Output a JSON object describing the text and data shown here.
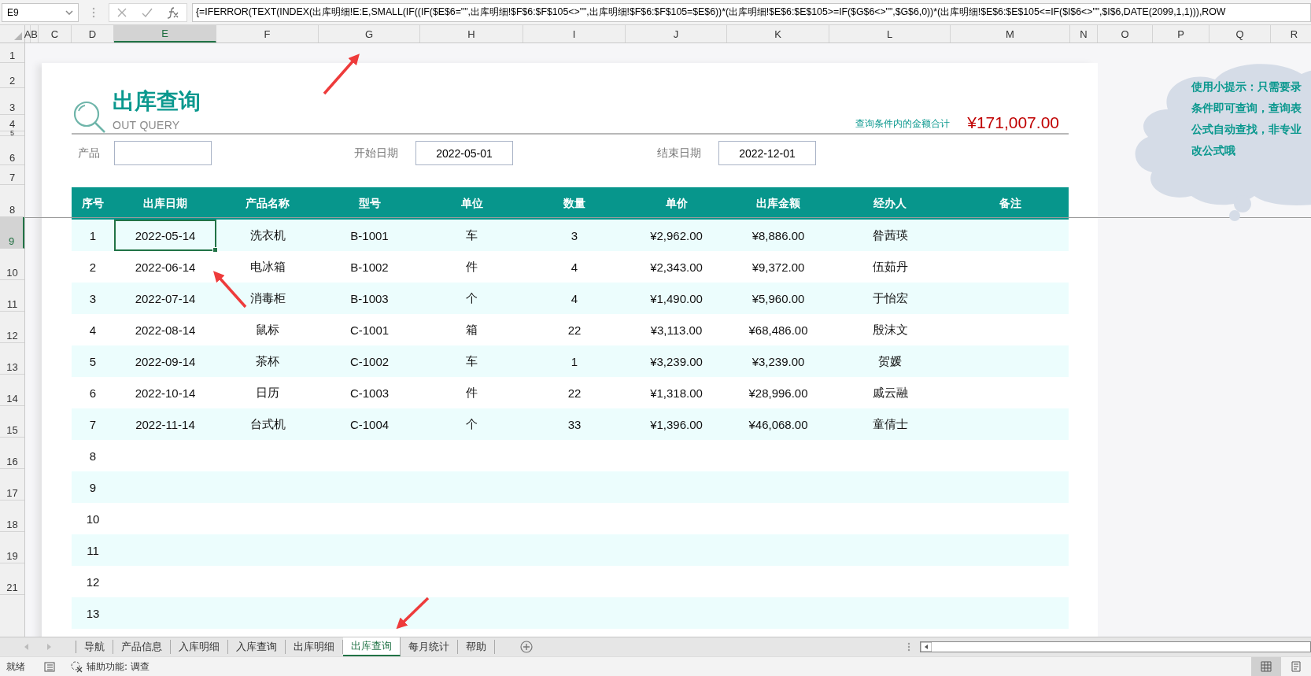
{
  "formula_bar": {
    "name_box": "E9",
    "formula": "{=IFERROR(TEXT(INDEX(出库明细!E:E,SMALL(IF((IF($E$6=\"\",出库明细!$F$6:$F$105<>\"\",出库明细!$F$6:$F$105=$E$6))*(出库明细!$E$6:$E$105>=IF($G$6<>\"\",$G$6,0))*(出库明细!$E$6:$E$105<=IF($I$6<>\"\",$I$6,DATE(2099,1,1))),ROW"
  },
  "column_headers": [
    {
      "label": "A",
      "selected": false
    },
    {
      "label": "B",
      "selected": false
    },
    {
      "label": "C",
      "selected": false
    },
    {
      "label": "D",
      "selected": false
    },
    {
      "label": "E",
      "selected": true
    },
    {
      "label": "F",
      "selected": false
    },
    {
      "label": "G",
      "selected": false
    },
    {
      "label": "H",
      "selected": false
    },
    {
      "label": "I",
      "selected": false
    },
    {
      "label": "J",
      "selected": false
    },
    {
      "label": "K",
      "selected": false
    },
    {
      "label": "L",
      "selected": false
    },
    {
      "label": "M",
      "selected": false
    },
    {
      "label": "N",
      "selected": false
    },
    {
      "label": "O",
      "selected": false
    },
    {
      "label": "P",
      "selected": false
    },
    {
      "label": "Q",
      "selected": false
    },
    {
      "label": "R",
      "selected": false
    }
  ],
  "row_headers": [
    {
      "label": "1",
      "selected": false
    },
    {
      "label": "2",
      "selected": false
    },
    {
      "label": "3",
      "selected": false
    },
    {
      "label": "4",
      "selected": false
    },
    {
      "label": "5",
      "selected": false
    },
    {
      "label": "6",
      "selected": false
    },
    {
      "label": "7",
      "selected": false
    },
    {
      "label": "8",
      "selected": false
    },
    {
      "label": "9",
      "selected": true
    },
    {
      "label": "10",
      "selected": false
    },
    {
      "label": "11",
      "selected": false
    },
    {
      "label": "12",
      "selected": false
    },
    {
      "label": "13",
      "selected": false
    },
    {
      "label": "14",
      "selected": false
    },
    {
      "label": "15",
      "selected": false
    },
    {
      "label": "16",
      "selected": false
    },
    {
      "label": "17",
      "selected": false
    },
    {
      "label": "18",
      "selected": false
    },
    {
      "label": "19",
      "selected": false
    },
    {
      "label": "21",
      "selected": false
    }
  ],
  "title": "出库查询",
  "subtitle": "OUT QUERY",
  "total_label": "查询条件内的金额合计",
  "total_amount": "¥171,007.00",
  "filters": [
    {
      "label": "产品"
    },
    {
      "label": "开始日期",
      "value": "2022-05-01"
    },
    {
      "label": "结束日期",
      "value": "2022-12-01"
    }
  ],
  "table": {
    "columns": [
      "序号",
      "出库日期",
      "产品名称",
      "型号",
      "单位",
      "数量",
      "单价",
      "出库金额",
      "经办人",
      "备注"
    ],
    "rows": [
      {
        "cells": [
          "1",
          "2022-05-14",
          "洗衣机",
          "B-1001",
          "车",
          "3",
          "¥2,962.00",
          "¥8,886.00",
          "昝茜瑛"
        ]
      },
      {
        "cells": [
          "2",
          "2022-06-14",
          "电冰箱",
          "B-1002",
          "件",
          "4",
          "¥2,343.00",
          "¥9,372.00",
          "伍茹丹"
        ]
      },
      {
        "cells": [
          "3",
          "2022-07-14",
          "消毒柜",
          "B-1003",
          "个",
          "4",
          "¥1,490.00",
          "¥5,960.00",
          "于怡宏"
        ]
      },
      {
        "cells": [
          "4",
          "2022-08-14",
          "鼠标",
          "C-1001",
          "箱",
          "22",
          "¥3,113.00",
          "¥68,486.00",
          "殷沫文"
        ]
      },
      {
        "cells": [
          "5",
          "2022-09-14",
          "茶杯",
          "C-1002",
          "车",
          "1",
          "¥3,239.00",
          "¥3,239.00",
          "贺媛"
        ]
      },
      {
        "cells": [
          "6",
          "2022-10-14",
          "日历",
          "C-1003",
          "件",
          "22",
          "¥1,318.00",
          "¥28,996.00",
          "戚云融"
        ]
      },
      {
        "cells": [
          "7",
          "2022-11-14",
          "台式机",
          "C-1004",
          "个",
          "33",
          "¥1,396.00",
          "¥46,068.00",
          "童倩士"
        ]
      },
      {
        "cells": [
          "8"
        ]
      },
      {
        "cells": [
          "9"
        ]
      },
      {
        "cells": [
          "10"
        ]
      },
      {
        "cells": [
          "11"
        ]
      },
      {
        "cells": [
          "12"
        ]
      },
      {
        "cells": [
          "13"
        ]
      }
    ]
  },
  "tip_lines": [
    "使用小提示：只需要录",
    "条件即可查询，查询表",
    "公式自动查找，非专业",
    "改公式哦"
  ],
  "sheet_tabs": [
    {
      "label": "导航",
      "selected": false
    },
    {
      "label": "产品信息",
      "selected": false
    },
    {
      "label": "入库明细",
      "selected": false
    },
    {
      "label": "入库查询",
      "selected": false
    },
    {
      "label": "出库明细",
      "selected": false
    },
    {
      "label": "出库查询",
      "selected": true
    },
    {
      "label": "每月统计",
      "selected": false
    },
    {
      "label": "帮助",
      "selected": false
    }
  ],
  "status_bar": {
    "ready": "就绪",
    "accessibility": "辅助功能: 调查"
  }
}
